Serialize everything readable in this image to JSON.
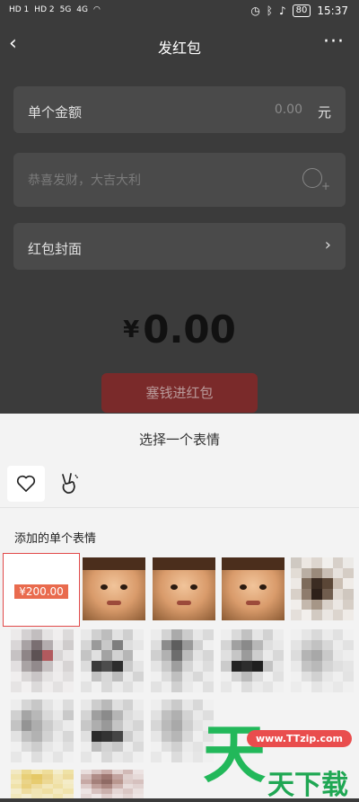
{
  "status_bar": {
    "left_labels": [
      "HD 1",
      "HD 2",
      "5G",
      "4G"
    ],
    "battery": "80",
    "time": "15:37"
  },
  "header": {
    "title": "发红包",
    "back_icon": "‹",
    "more_icon": "···"
  },
  "form": {
    "amount_label": "单个金额",
    "amount_value": "0.00",
    "amount_unit": "元",
    "greeting_placeholder": "恭喜发财，大吉大利",
    "cover_label": "红包封面",
    "total_currency": "¥",
    "total_value": "0.00",
    "send_button": "塞钱进红包"
  },
  "sheet": {
    "title": "选择一个表情",
    "section_label": "添加的单个表情",
    "tabs": [
      {
        "name": "favorites",
        "icon": "heart-icon"
      },
      {
        "name": "peace",
        "icon": "peace-hand-icon"
      }
    ],
    "money_sticker_text": "¥200.00"
  },
  "watermark": {
    "big": "天",
    "url": "www.TTzip.com",
    "small": "天下载"
  }
}
